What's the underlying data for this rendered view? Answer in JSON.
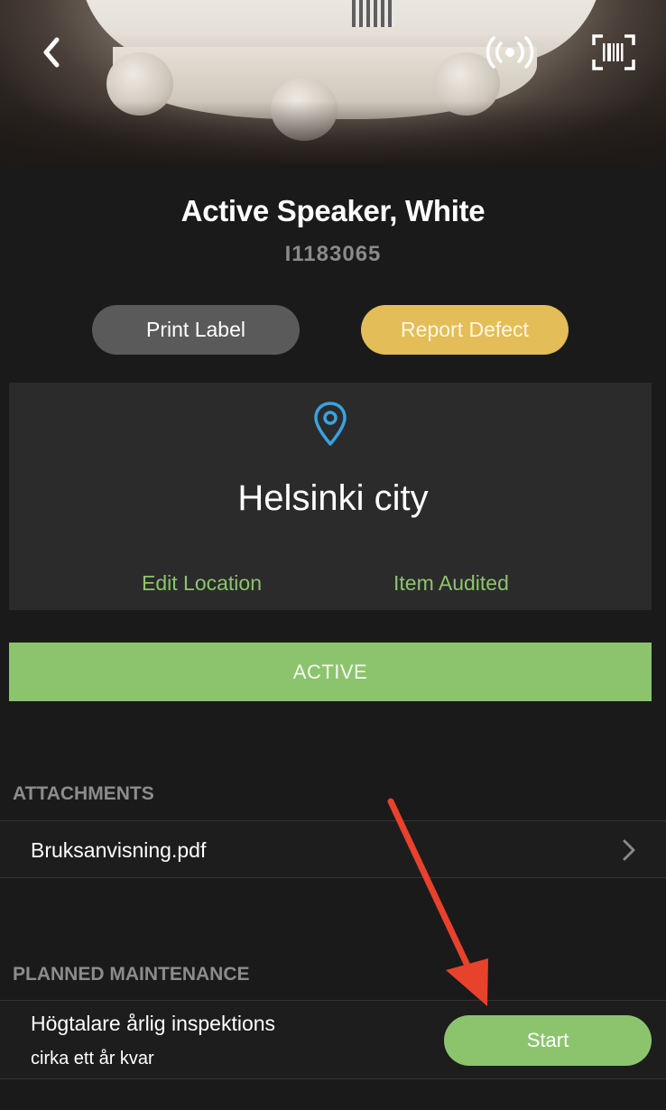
{
  "item": {
    "title": "Active Speaker, White",
    "id": "I1183065"
  },
  "actions": {
    "print_label": "Print Label",
    "report_defect": "Report Defect"
  },
  "location": {
    "name": "Helsinki city",
    "edit_label": "Edit Location",
    "audit_label": "Item Audited"
  },
  "status": {
    "label": "ACTIVE",
    "color": "#8cc46e"
  },
  "attachments": {
    "header": "ATTACHMENTS",
    "items": [
      {
        "name": "Bruksanvisning.pdf"
      }
    ]
  },
  "maintenance": {
    "header": "PLANNED MAINTENANCE",
    "items": [
      {
        "title": "Högtalare årlig inspektions",
        "subtitle": "cirka ett år kvar",
        "action_label": "Start"
      }
    ]
  },
  "icons": {
    "back": "chevron-left-icon",
    "nfc": "nfc-signal-icon",
    "barcode": "barcode-scan-icon",
    "location": "location-pin-icon",
    "row_chevron": "chevron-right-icon"
  },
  "colors": {
    "accent_green": "#8cc46e",
    "accent_gold": "#e3bd57",
    "pin_blue": "#3aa3e0",
    "annotation_red": "#e8412c"
  }
}
